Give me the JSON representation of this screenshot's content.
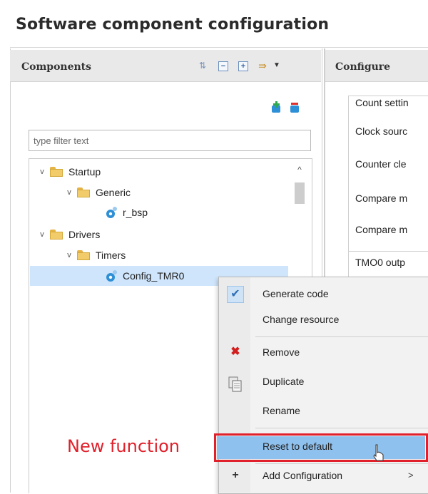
{
  "page": {
    "title": "Software component configuration"
  },
  "components": {
    "title": "Components",
    "filter_placeholder": "type filter text",
    "tree": [
      {
        "label": "Startup"
      },
      {
        "label": "Generic"
      },
      {
        "label": "r_bsp"
      },
      {
        "label": "Drivers"
      },
      {
        "label": "Timers"
      },
      {
        "label": "Config_TMR0"
      }
    ]
  },
  "configure": {
    "title": "Configure",
    "lines": [
      "Count settin",
      "Clock sourc",
      "Counter cle",
      "Compare m",
      "Compare m",
      "TMO0 outp"
    ]
  },
  "context_menu": {
    "items": {
      "generate_code": "Generate code",
      "change_resource": "Change resource",
      "remove": "Remove",
      "duplicate": "Duplicate",
      "rename": "Rename",
      "reset_to_default": "Reset to default",
      "add_configuration": "Add Configuration",
      "submenu_arrow": ">"
    },
    "checked_item": "Generate code",
    "hovered_item": "Reset to default"
  },
  "annotation": {
    "text": "New function",
    "color": "#e0202a"
  },
  "colors": {
    "selection": "#cfe5fb",
    "menu_hover": "#8fc1ee",
    "highlight_border": "#e0202a"
  }
}
